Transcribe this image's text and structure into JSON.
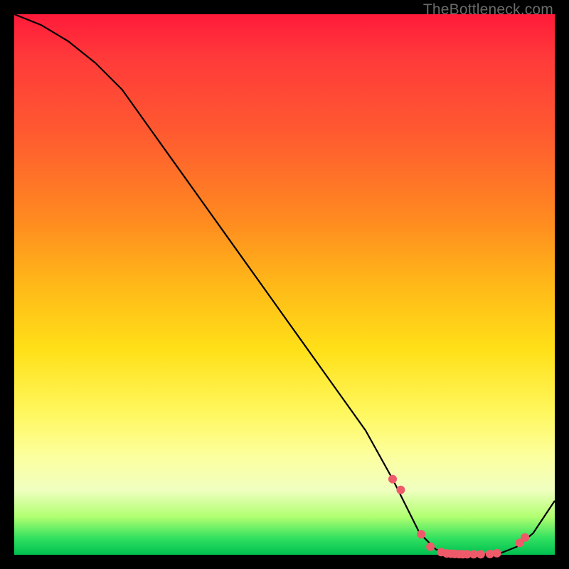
{
  "watermark": "TheBottleneck.com",
  "chart_data": {
    "type": "line",
    "title": "",
    "xlabel": "",
    "ylabel": "",
    "xlim": [
      0,
      100
    ],
    "ylim": [
      0,
      100
    ],
    "grid": false,
    "series": [
      {
        "name": "bottleneck-curve",
        "x": [
          0,
          5,
          10,
          15,
          20,
          25,
          30,
          35,
          40,
          45,
          50,
          55,
          60,
          65,
          70,
          72,
          75,
          78,
          80,
          83,
          86,
          90,
          93,
          96,
          100
        ],
        "y": [
          100,
          98,
          95,
          91,
          86,
          79,
          72,
          65,
          58,
          51,
          44,
          37,
          30,
          23,
          14,
          10,
          4,
          1,
          0.3,
          0,
          0,
          0.3,
          1.5,
          4,
          10
        ]
      }
    ],
    "markers": {
      "name": "highlight-points",
      "x": [
        70.0,
        71.5,
        75.3,
        77.0,
        79.0,
        80.0,
        80.8,
        81.5,
        82.3,
        83.0,
        83.8,
        85.0,
        86.3,
        88.0,
        89.3,
        93.5,
        94.5
      ],
      "y": [
        14.0,
        12.0,
        3.8,
        1.5,
        0.5,
        0.25,
        0.2,
        0.15,
        0.12,
        0.1,
        0.1,
        0.1,
        0.1,
        0.15,
        0.3,
        2.2,
        3.2
      ],
      "color": "#ef5a6a",
      "radius": 6
    }
  },
  "colors": {
    "background": "#000000",
    "curve": "#000000",
    "marker": "#ef5a6a",
    "watermark": "#6b6b6b"
  }
}
